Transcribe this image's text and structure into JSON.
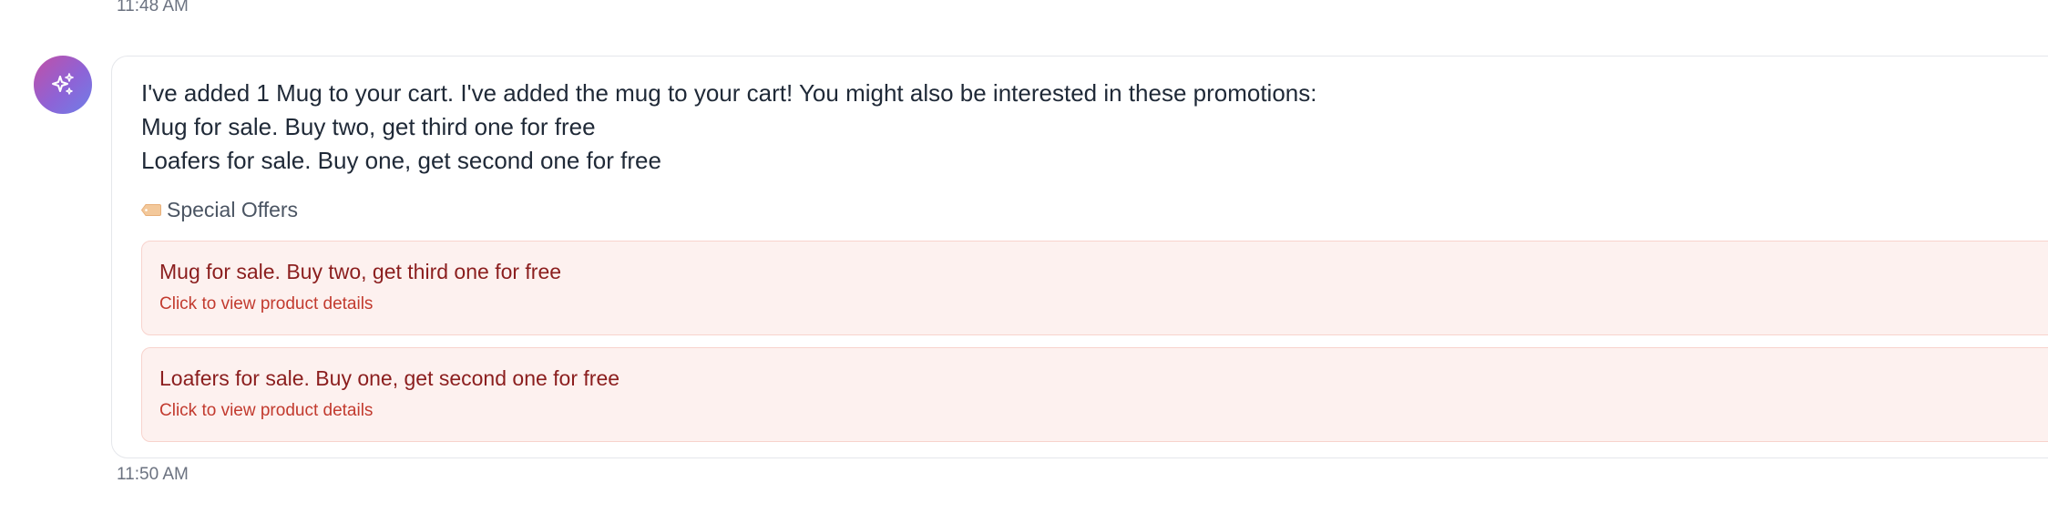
{
  "messages": {
    "previous_timestamp": "11:48 AM",
    "assistant": {
      "avatar_icon": "sparkles-icon",
      "avatar_gradient": [
        "#c14fa6",
        "#6e7fe8"
      ],
      "lines": [
        "I've added 1 Mug to your cart. I've added the mug to your cart! You might also be interested in these promotions:",
        "Mug for sale. Buy two, get third one for free",
        "Loafers for sale. Buy one, get second one for free"
      ],
      "offers_heading": "Special Offers",
      "offers_icon": "tag-icon",
      "offers": [
        {
          "title": "Mug for sale. Buy two, get third one for free",
          "subtitle": "Click to view product details"
        },
        {
          "title": "Loafers for sale. Buy one, get second one for free",
          "subtitle": "Click to view product details"
        }
      ],
      "timestamp": "11:50 AM"
    }
  },
  "colors": {
    "offer_bg": "#fdf1ef",
    "offer_border": "#f8d3cd",
    "offer_title": "#8b1e1e",
    "offer_subtitle": "#c23a2e"
  }
}
